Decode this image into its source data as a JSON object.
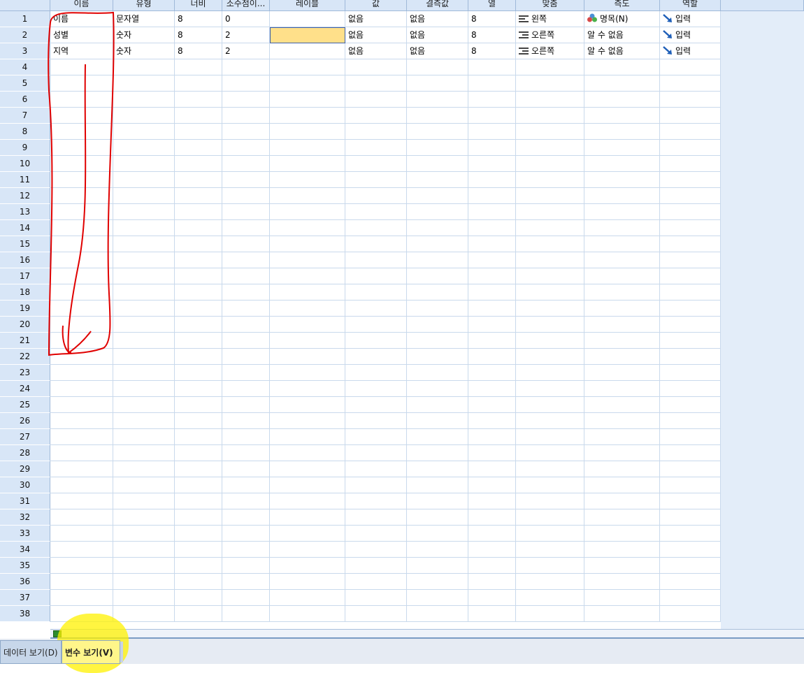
{
  "columns": [
    "이름",
    "유형",
    "너비",
    "소수점이...",
    "레이블",
    "값",
    "결측값",
    "열",
    "맞춤",
    "측도",
    "역할"
  ],
  "row_numbers": [
    "1",
    "2",
    "3",
    "4",
    "5",
    "6",
    "7",
    "8",
    "9",
    "10",
    "11",
    "12",
    "13",
    "14",
    "15",
    "16",
    "17",
    "18",
    "19",
    "20",
    "21",
    "22",
    "23",
    "24",
    "25",
    "26",
    "27",
    "28",
    "29",
    "30",
    "31",
    "32",
    "33",
    "34",
    "35",
    "36",
    "37",
    "38"
  ],
  "variables": [
    {
      "name": "이름",
      "type": "문자열",
      "width": "8",
      "decimals": "0",
      "label": "",
      "values": "없음",
      "missing": "없음",
      "columns": "8",
      "align": "왼쪽",
      "measure": "명목(N)",
      "role": "입력"
    },
    {
      "name": "성별",
      "type": "숫자",
      "width": "8",
      "decimals": "2",
      "label": "",
      "values": "없음",
      "missing": "없음",
      "columns": "8",
      "align": "오른쪽",
      "measure": "알 수 없음",
      "role": "입력"
    },
    {
      "name": "지역",
      "type": "숫자",
      "width": "8",
      "decimals": "2",
      "label": "",
      "values": "없음",
      "missing": "없음",
      "columns": "8",
      "align": "오른쪽",
      "measure": "알 수 없음",
      "role": "입력"
    }
  ],
  "icons": {
    "align_left": "align-left-icon",
    "align_right": "align-right-icon",
    "measure_nominal": "nominal-measure-icon",
    "role_input": "input-role-icon"
  },
  "selected_cell": {
    "row": "2",
    "column": "레이블"
  },
  "tabs": {
    "data_view": "데이터 보기(D)",
    "variable_view": "변수 보기(V)"
  },
  "colors": {
    "header_bg": "#d8e6f7",
    "grid_line": "#c9d9ec",
    "selected_cell": "#ffe08a",
    "annotation_red": "#e00000",
    "highlight_yellow": "#fff200"
  }
}
